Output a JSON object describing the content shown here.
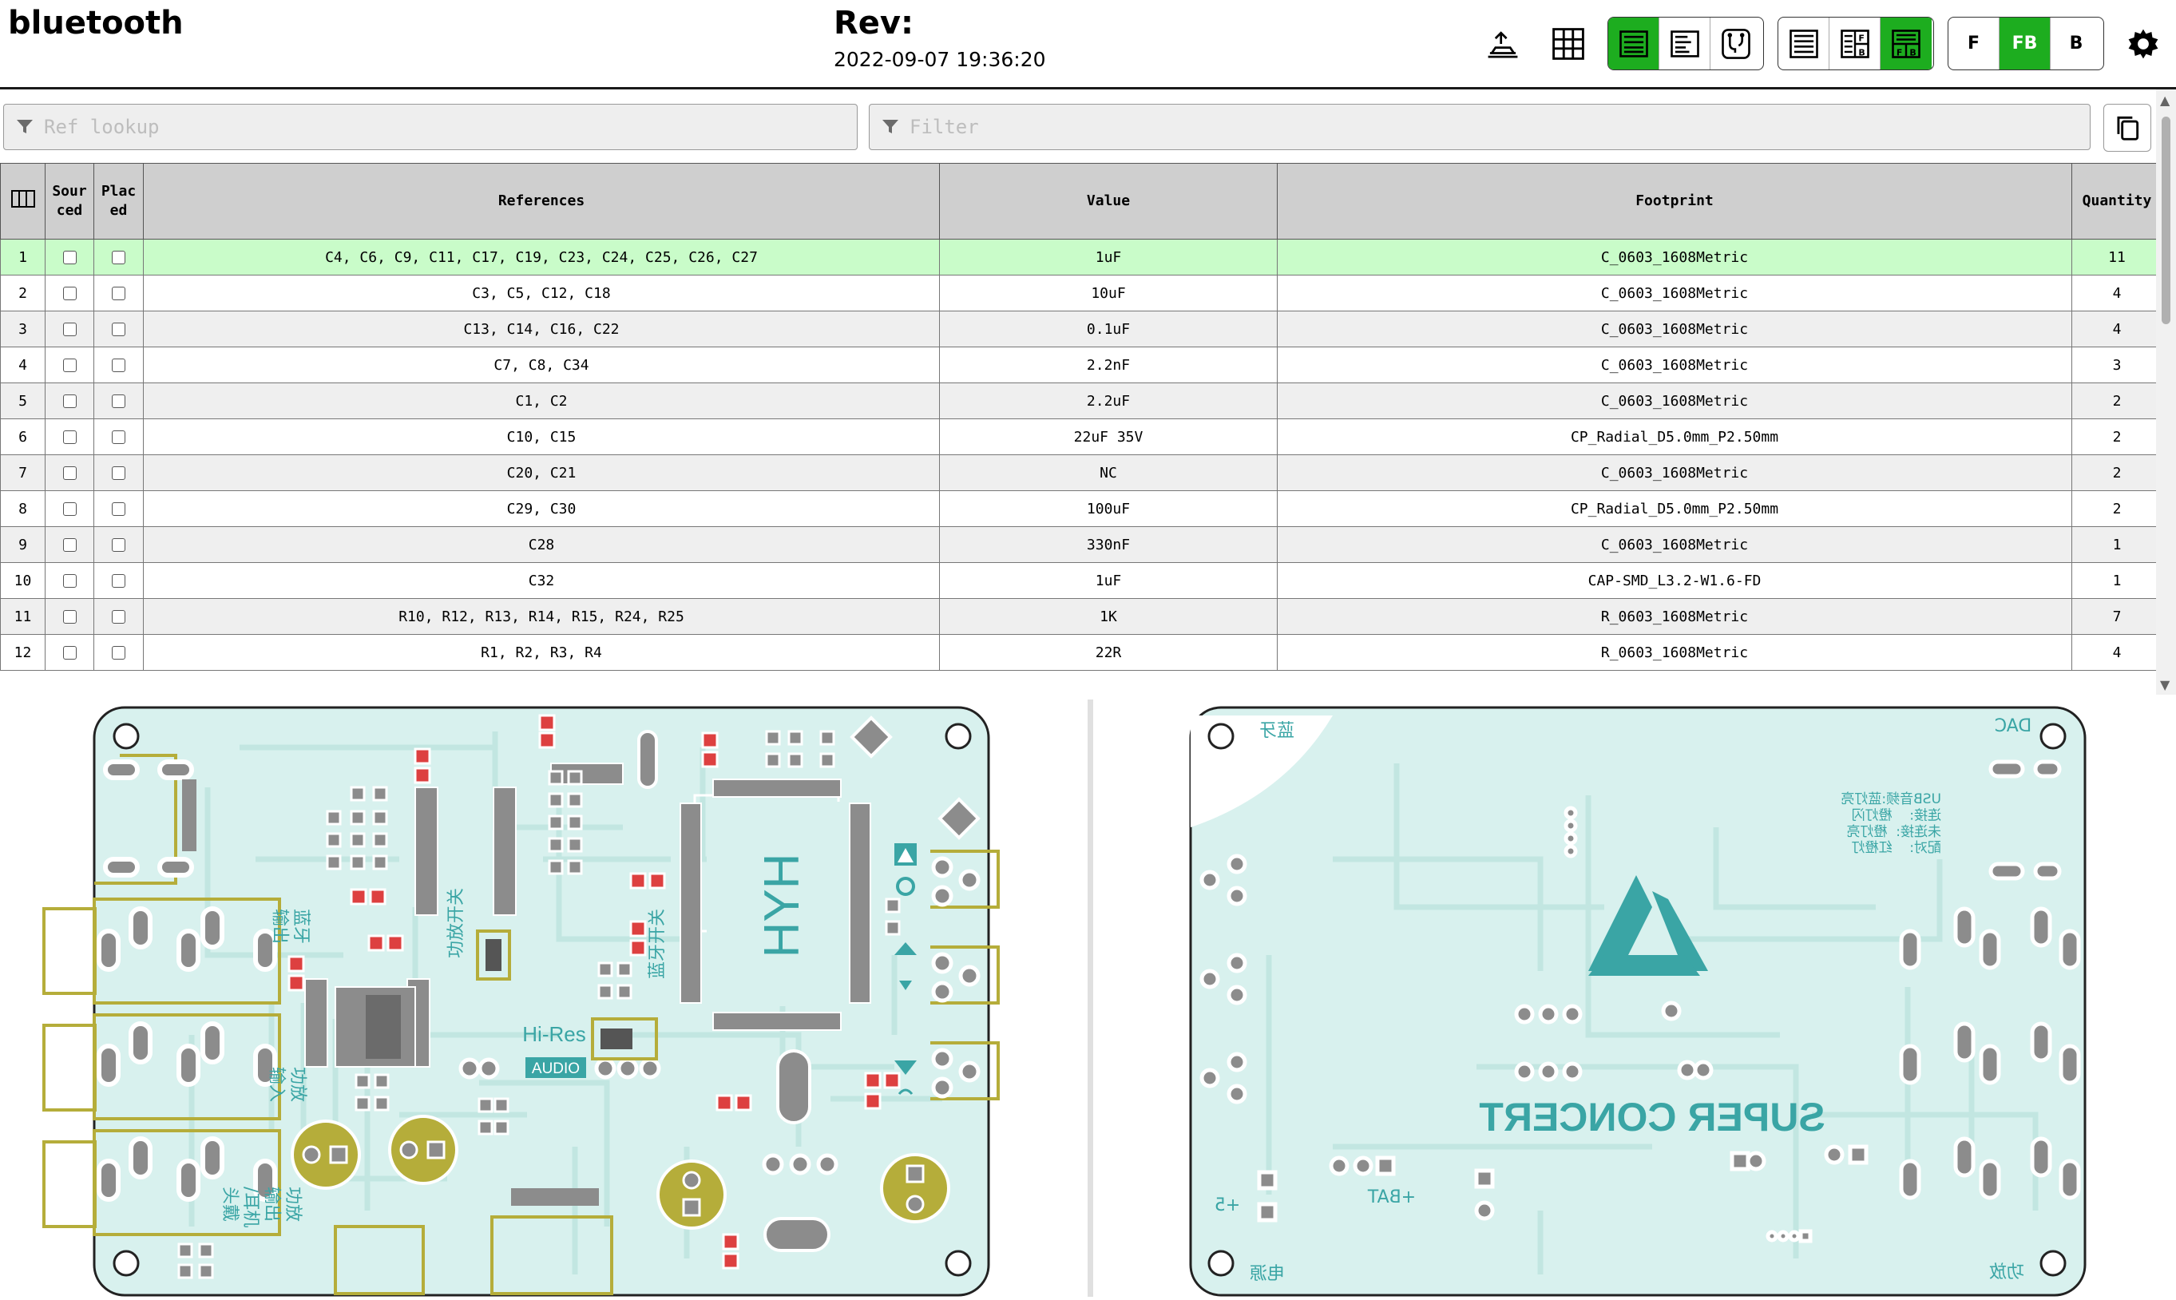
{
  "header": {
    "title": "bluetooth",
    "rev_label": "Rev:",
    "date": "2022-09-07 19:36:20"
  },
  "toolbar": {
    "layer_buttons": [
      "F",
      "FB",
      "B"
    ],
    "active_layer": "FB",
    "accent_color": "#1dad1f"
  },
  "filters": {
    "ref_lookup_placeholder": "Ref lookup",
    "filter_placeholder": "Filter"
  },
  "bom": {
    "columns": {
      "index": "",
      "sourced": "Sour\nced",
      "placed": "Plac\ned",
      "references": "References",
      "value": "Value",
      "footprint": "Footprint",
      "quantity": "Quantity"
    },
    "rows": [
      {
        "n": "1",
        "refs": "C4, C6, C9, C11, C17, C19, C23, C24, C25, C26, C27",
        "value": "1uF",
        "footprint": "C_0603_1608Metric",
        "qty": "11",
        "highlighted": true
      },
      {
        "n": "2",
        "refs": "C3, C5, C12, C18",
        "value": "10uF",
        "footprint": "C_0603_1608Metric",
        "qty": "4"
      },
      {
        "n": "3",
        "refs": "C13, C14, C16, C22",
        "value": "0.1uF",
        "footprint": "C_0603_1608Metric",
        "qty": "4"
      },
      {
        "n": "4",
        "refs": "C7, C8, C34",
        "value": "2.2nF",
        "footprint": "C_0603_1608Metric",
        "qty": "3"
      },
      {
        "n": "5",
        "refs": "C1, C2",
        "value": "2.2uF",
        "footprint": "C_0603_1608Metric",
        "qty": "2"
      },
      {
        "n": "6",
        "refs": "C10, C15",
        "value": "22uF 35V",
        "footprint": "CP_Radial_D5.0mm_P2.50mm",
        "qty": "2"
      },
      {
        "n": "7",
        "refs": "C20, C21",
        "value": "NC",
        "footprint": "C_0603_1608Metric",
        "qty": "2"
      },
      {
        "n": "8",
        "refs": "C29, C30",
        "value": "100uF",
        "footprint": "CP_Radial_D5.0mm_P2.50mm",
        "qty": "2"
      },
      {
        "n": "9",
        "refs": "C28",
        "value": "330nF",
        "footprint": "C_0603_1608Metric",
        "qty": "1"
      },
      {
        "n": "10",
        "refs": "C32",
        "value": "1uF",
        "footprint": "CAP-SMD_L3.2-W1.6-FD",
        "qty": "1"
      },
      {
        "n": "11",
        "refs": "R10, R12, R13, R14, R15, R24, R25",
        "value": "1K",
        "footprint": "R_0603_1608Metric",
        "qty": "7"
      },
      {
        "n": "12",
        "refs": "R1, R2, R3, R4",
        "value": "22R",
        "footprint": "R_0603_1608Metric",
        "qty": "4"
      }
    ]
  },
  "front_board": {
    "silkscreen": {
      "bt_out": "蓝牙\n输出",
      "amp_switch": "功放开关",
      "bt_switch": "蓝牙开关",
      "amp_in": "功放\n输入",
      "amp_out_headphone": "功放\n输出\n/耳机\n头戴",
      "hires_top": "Hi-Res",
      "hires_bottom": "AUDIO",
      "mcu_mark": "HYH"
    }
  },
  "back_board": {
    "silkscreen": {
      "bt": "蓝牙",
      "dac": "DAC",
      "brand": "SUPER CONCERT",
      "plus5": "+5",
      "bat": "+BAT",
      "power": "电源",
      "amp": "功放",
      "note": "USB音频:蓝灯亮\n连接:    橙灯闪\n未连接:  橙灯亮\n配对:    红橙灯"
    }
  },
  "colors": {
    "board_fill": "#d8f1ee",
    "board_trace": "#c2e6e1",
    "board_edge": "#222222",
    "pad_gray": "#8c8c8c",
    "silk_teal": "#3aa5a5",
    "component_olive": "#b5ad3a",
    "highlight_red": "#dd4040",
    "row_highlight": "#c9fcc9"
  }
}
